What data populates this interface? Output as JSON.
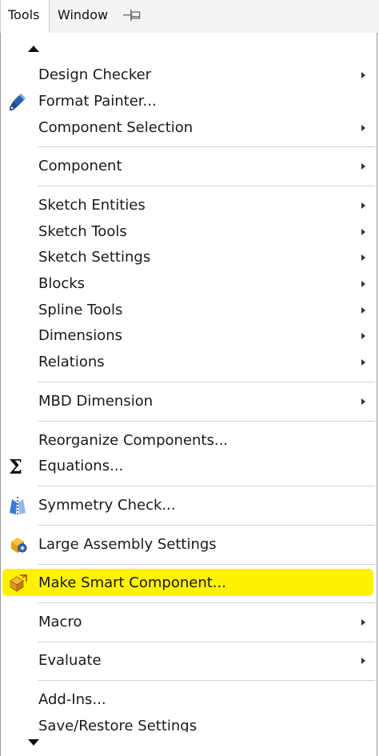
{
  "menubar": {
    "tools_label": "Tools",
    "window_label": "Window",
    "pin_icon": "pin-icon"
  },
  "menu": {
    "items": [
      {
        "label": "Design Checker",
        "submenu": true
      },
      {
        "label": "Format Painter...",
        "icon": "format-painter-icon"
      },
      {
        "label": "Component Selection",
        "submenu": true
      },
      {
        "label": "Component",
        "submenu": true
      },
      {
        "label": "Sketch Entities",
        "submenu": true
      },
      {
        "label": "Sketch Tools",
        "submenu": true
      },
      {
        "label": "Sketch Settings",
        "submenu": true
      },
      {
        "label": "Blocks",
        "submenu": true
      },
      {
        "label": "Spline Tools",
        "submenu": true
      },
      {
        "label": "Dimensions",
        "submenu": true
      },
      {
        "label": "Relations",
        "submenu": true
      },
      {
        "label": "MBD Dimension",
        "submenu": true
      },
      {
        "label": "Reorganize Components..."
      },
      {
        "label": "Equations...",
        "icon": "sigma-icon"
      },
      {
        "label": "Symmetry Check...",
        "icon": "symmetry-check-icon"
      },
      {
        "label": "Large Assembly Settings",
        "icon": "large-assembly-icon"
      },
      {
        "label": "Make Smart Component...",
        "icon": "smart-component-icon",
        "highlighted": true
      },
      {
        "label": "Macro",
        "submenu": true
      },
      {
        "label": "Evaluate",
        "submenu": true
      },
      {
        "label": "Add-Ins..."
      },
      {
        "label": "Save/Restore Settings"
      }
    ],
    "highlight_color": "#fff200"
  }
}
